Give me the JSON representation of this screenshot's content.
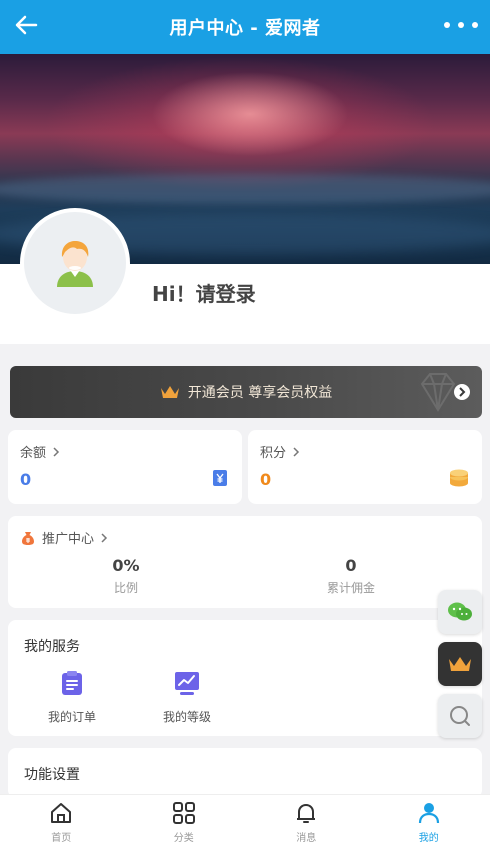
{
  "header": {
    "title": "用户中心 - 爱网者"
  },
  "profile": {
    "greeting": "Hi！请登录"
  },
  "vip": {
    "label": "开通会员 尊享会员权益"
  },
  "balance": {
    "title": "余额",
    "value": "0"
  },
  "points": {
    "title": "积分",
    "value": "0"
  },
  "promotion": {
    "title": "推广中心",
    "ratio_value": "0%",
    "ratio_label": "比例",
    "commission_value": "0",
    "commission_label": "累计佣金"
  },
  "services": {
    "title": "我的服务",
    "items": [
      {
        "label": "我的订单",
        "icon": "clipboard-icon"
      },
      {
        "label": "我的等级",
        "icon": "chart-icon"
      }
    ]
  },
  "settings": {
    "title": "功能设置"
  },
  "tabs": [
    {
      "label": "首页",
      "icon": "home-icon"
    },
    {
      "label": "分类",
      "icon": "grid-icon"
    },
    {
      "label": "消息",
      "icon": "bell-icon"
    },
    {
      "label": "我的",
      "icon": "user-icon",
      "active": true
    }
  ],
  "colors": {
    "primary": "#1aa0e4",
    "balance": "#4a7de8",
    "points": "#f08a1c",
    "vip_crown": "#f0a23c"
  }
}
